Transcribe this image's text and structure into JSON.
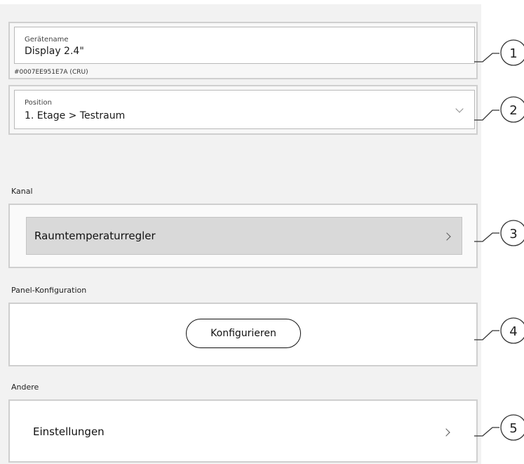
{
  "device": {
    "name_label": "Gerätename",
    "name_value": "Display 2.4\"",
    "device_id": "#0007EE951E7A (CRU)"
  },
  "position": {
    "label": "Position",
    "value": "1. Etage > Testraum"
  },
  "channel": {
    "section_label": "Kanal",
    "item_label": "Raumtemperaturregler"
  },
  "panel_config": {
    "section_label": "Panel-Konfiguration",
    "button_label": "Konfigurieren"
  },
  "other": {
    "section_label": "Andere",
    "item_label": "Einstellungen"
  },
  "callouts": [
    "1",
    "2",
    "3",
    "4",
    "5"
  ]
}
